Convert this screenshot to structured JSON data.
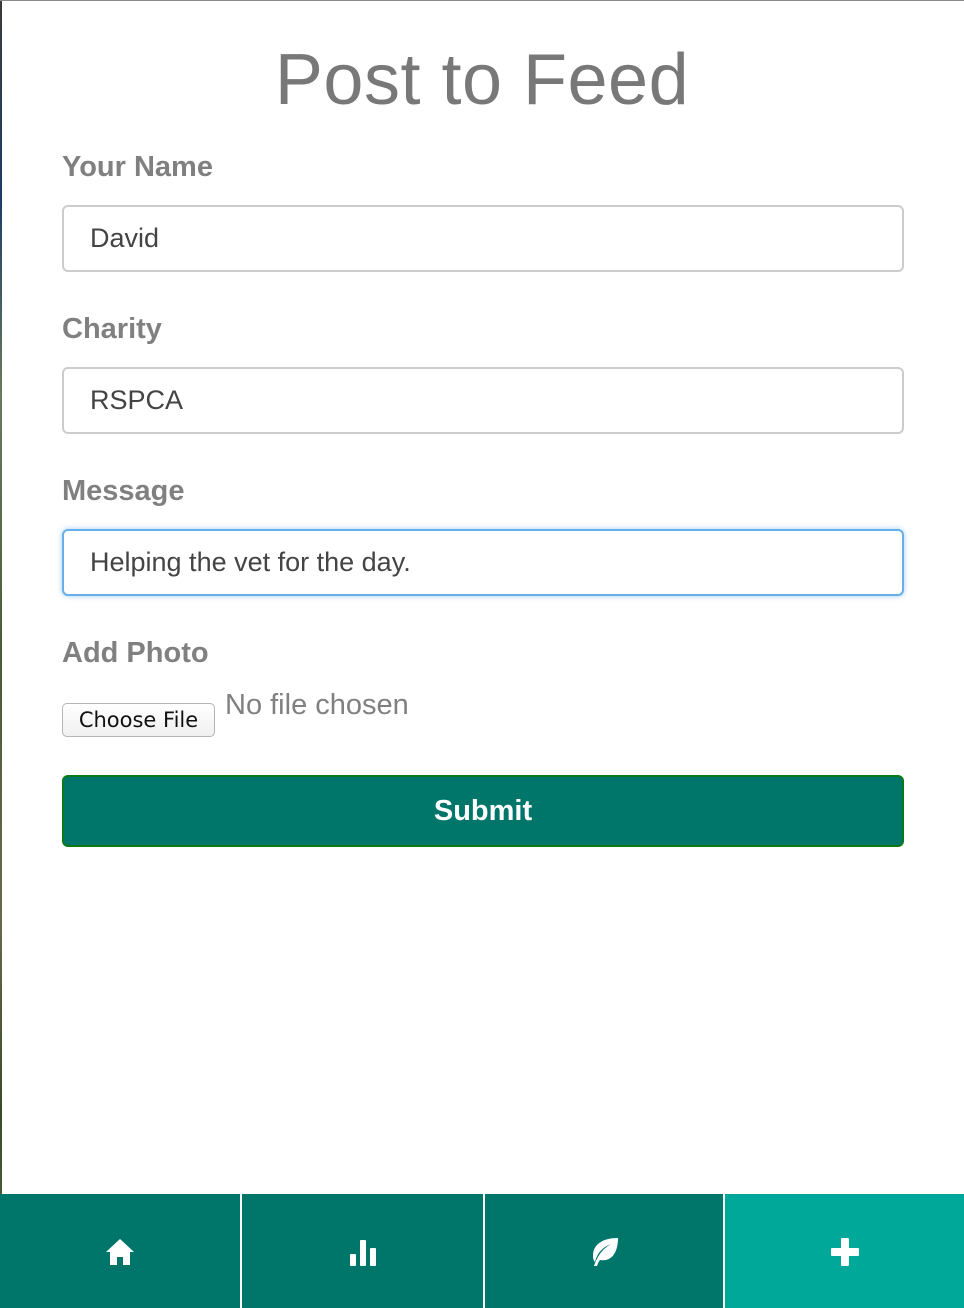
{
  "page": {
    "title": "Post to Feed"
  },
  "form": {
    "name_label": "Your Name",
    "name_value": "David",
    "charity_label": "Charity",
    "charity_value": "RSPCA",
    "message_label": "Message",
    "message_value": "Helping the vet for the day.",
    "photo_label": "Add Photo",
    "choose_file_label": "Choose File",
    "file_status": "No file chosen",
    "submit_label": "Submit"
  },
  "tabbar": {
    "items": [
      {
        "icon": "home-icon",
        "active": false
      },
      {
        "icon": "bar-chart-icon",
        "active": false
      },
      {
        "icon": "leaf-icon",
        "active": false
      },
      {
        "icon": "plus-icon",
        "active": true
      }
    ]
  },
  "colors": {
    "brand_teal": "#00766a",
    "active_teal": "#00a89a",
    "focus_blue": "#66afe9",
    "label_gray": "#808080"
  }
}
